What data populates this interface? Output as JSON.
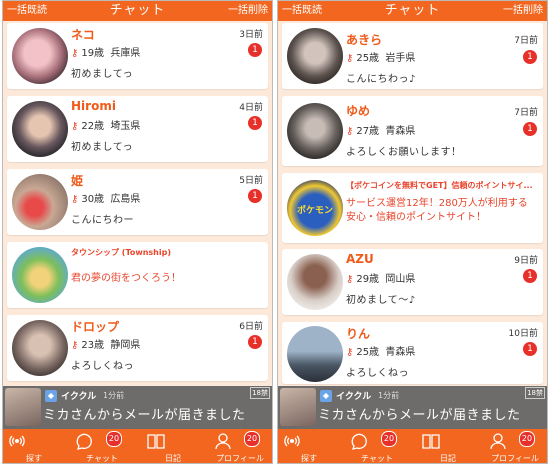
{
  "header": {
    "mark_all_read": "一括既読",
    "title": "チャット",
    "delete_all": "一括削除"
  },
  "left": {
    "chats": [
      {
        "name": "ネコ",
        "age": "19歳",
        "region": "兵庫県",
        "message": "初めましてっ",
        "time": "3日前",
        "badge": "1"
      },
      {
        "name": "Hiromi",
        "age": "22歳",
        "region": "埼玉県",
        "message": "初めましてっ",
        "time": "4日前",
        "badge": "1"
      },
      {
        "name": "姫",
        "age": "30歳",
        "region": "広島県",
        "message": "こんにちわー",
        "time": "5日前",
        "badge": "1"
      },
      {
        "ad_title": "タウンシップ (Township)",
        "ad_text": "君の夢の街をつくろう！"
      },
      {
        "name": "ドロップ",
        "age": "23歳",
        "region": "静岡県",
        "message": "よろしくねっ",
        "time": "6日前",
        "badge": "1"
      }
    ]
  },
  "right": {
    "chats": [
      {
        "name": "あきら",
        "age": "25歳",
        "region": "岩手県",
        "message": "こんにちわっ♪",
        "time": "7日前",
        "badge": "1"
      },
      {
        "name": "ゆめ",
        "age": "27歳",
        "region": "青森県",
        "message": "よろしくお願いします！",
        "time": "7日前",
        "badge": "1"
      },
      {
        "ad_title": "【ポケコインを無料でGET】信頼のポイントサイ...",
        "ad_text": "サービス運営12年！280万人が利用する安心・信頼のポイントサイト！",
        "ad_image_label": "ポケモン"
      },
      {
        "name": "AZU",
        "age": "29歳",
        "region": "岡山県",
        "message": "初めまして〜♪",
        "time": "9日前",
        "badge": "1"
      },
      {
        "name": "りん",
        "age": "25歳",
        "region": "青森県",
        "message": "よろしくねっ",
        "time": "10日前",
        "badge": "1"
      }
    ]
  },
  "notification": {
    "app": "イククル",
    "ago": "1分前",
    "text": "ミカさんからメールが届きました",
    "age_mark": "18禁",
    "mail_badge": "2"
  },
  "tabs": [
    {
      "label": "探す",
      "icon": "radar-icon"
    },
    {
      "label": "チャット",
      "icon": "chat-icon",
      "badge": "20"
    },
    {
      "label": "日記",
      "icon": "book-icon"
    },
    {
      "label": "プロフィール",
      "icon": "person-icon",
      "badge": "20"
    }
  ],
  "colors": {
    "accent": "#f3661f",
    "badge": "#e8302a",
    "background": "#fde9d9"
  }
}
